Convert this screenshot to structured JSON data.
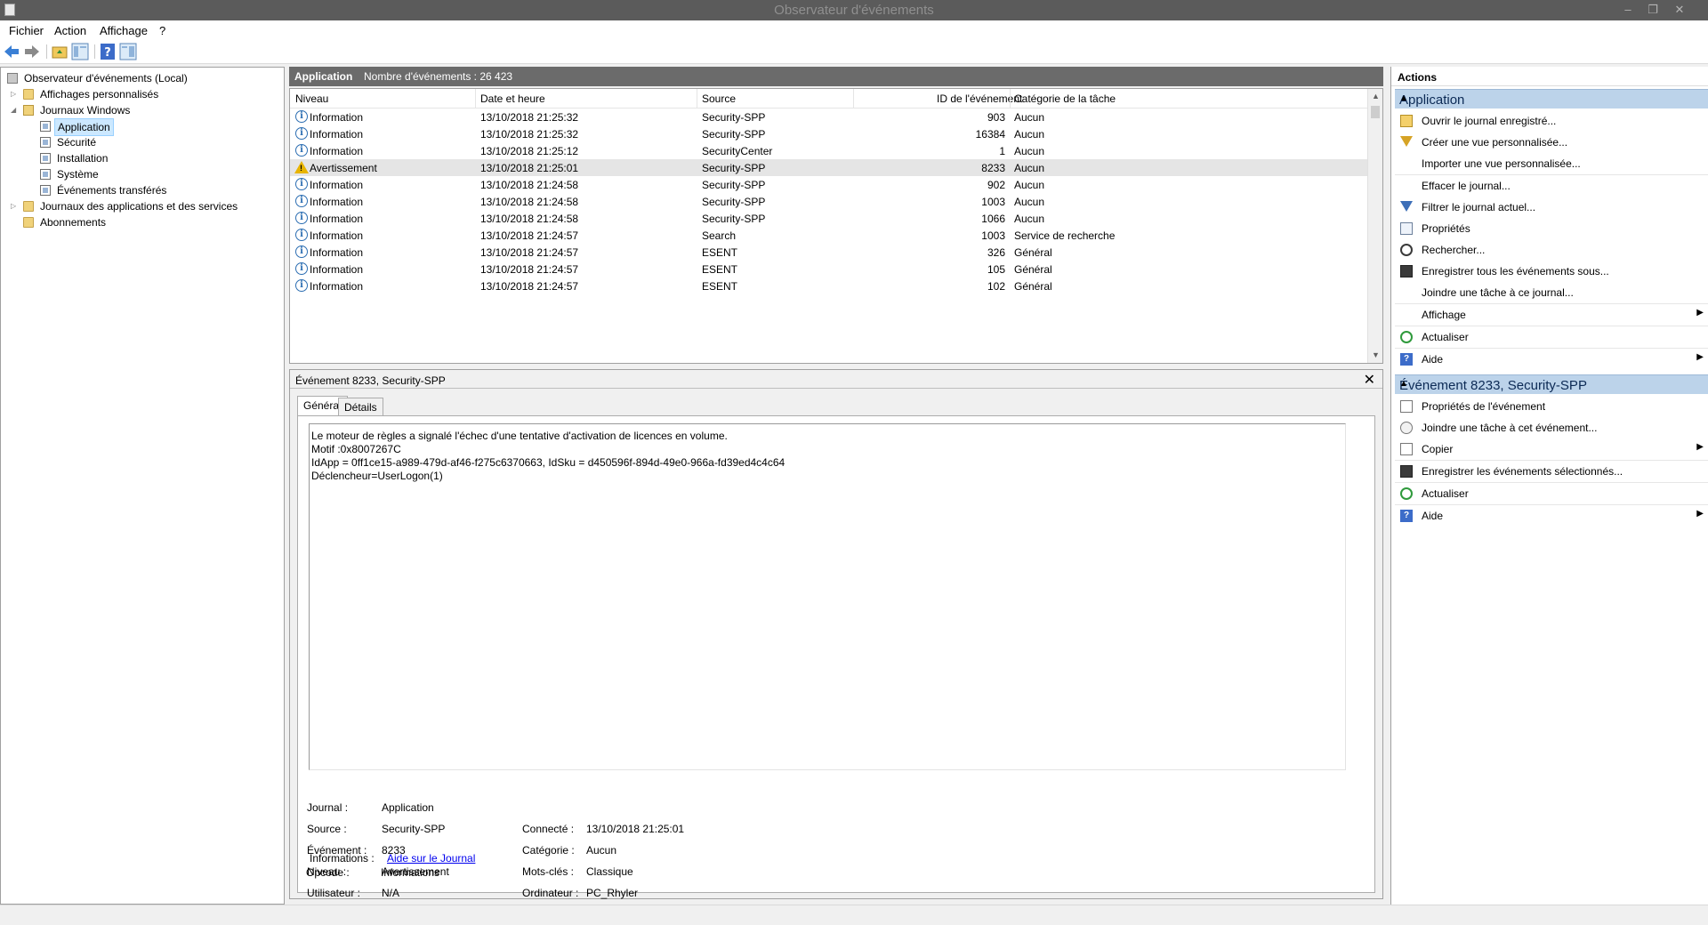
{
  "window": {
    "title": "Observateur d'événements"
  },
  "menu": [
    "Fichier",
    "Action",
    "Affichage",
    "?"
  ],
  "tree": {
    "root": "Observateur d'événements (Local)",
    "custom_views": "Affichages personnalisés",
    "windows_logs": "Journaux Windows",
    "logs": [
      "Application",
      "Sécurité",
      "Installation",
      "Système",
      "Événements transférés"
    ],
    "app_services_logs": "Journaux des applications et des services",
    "subscriptions": "Abonnements"
  },
  "list": {
    "title": "Application",
    "count_text": "Nombre d'événements : 26 423",
    "columns": [
      "Niveau",
      "Date et heure",
      "Source",
      "ID de l'événement",
      "Catégorie de la tâche"
    ],
    "rows": [
      {
        "level": "Information",
        "date": "13/10/2018 21:25:32",
        "source": "Security-SPP",
        "id": "903",
        "category": "Aucun"
      },
      {
        "level": "Information",
        "date": "13/10/2018 21:25:32",
        "source": "Security-SPP",
        "id": "16384",
        "category": "Aucun"
      },
      {
        "level": "Information",
        "date": "13/10/2018 21:25:12",
        "source": "SecurityCenter",
        "id": "1",
        "category": "Aucun"
      },
      {
        "level": "Avertissement",
        "date": "13/10/2018 21:25:01",
        "source": "Security-SPP",
        "id": "8233",
        "category": "Aucun"
      },
      {
        "level": "Information",
        "date": "13/10/2018 21:24:58",
        "source": "Security-SPP",
        "id": "902",
        "category": "Aucun"
      },
      {
        "level": "Information",
        "date": "13/10/2018 21:24:58",
        "source": "Security-SPP",
        "id": "1003",
        "category": "Aucun"
      },
      {
        "level": "Information",
        "date": "13/10/2018 21:24:58",
        "source": "Security-SPP",
        "id": "1066",
        "category": "Aucun"
      },
      {
        "level": "Information",
        "date": "13/10/2018 21:24:57",
        "source": "Search",
        "id": "1003",
        "category": "Service de recherche"
      },
      {
        "level": "Information",
        "date": "13/10/2018 21:24:57",
        "source": "ESENT",
        "id": "326",
        "category": "Général"
      },
      {
        "level": "Information",
        "date": "13/10/2018 21:24:57",
        "source": "ESENT",
        "id": "105",
        "category": "Général"
      },
      {
        "level": "Information",
        "date": "13/10/2018 21:24:57",
        "source": "ESENT",
        "id": "102",
        "category": "Général"
      }
    ]
  },
  "detail": {
    "title": "Événement 8233, Security-SPP",
    "tabs": [
      "Général",
      "Détails"
    ],
    "message": [
      "Le moteur de règles a signalé l'échec d'une tentative d'activation de licences en volume.",
      "Motif :0x8007267C",
      "IdApp = 0ff1ce15-a989-479d-af46-f275c6370663, IdSku = d450596f-894d-49e0-966a-fd39ed4c4c64",
      "Déclencheur=UserLogon(1)"
    ],
    "fields": {
      "journal_label": "Journal :",
      "journal": "Application",
      "source_label": "Source :",
      "source": "Security-SPP",
      "event_label": "Événement :",
      "event": "8233",
      "level_label": "Niveau :",
      "level": "Avertissement",
      "user_label": "Utilisateur :",
      "user": "N/A",
      "opcode_label": "Opcode :",
      "opcode": "Informations",
      "info_label": "Informations :",
      "info_link": "Aide sur le Journal",
      "logged_label": "Connecté :",
      "logged": "13/10/2018 21:25:01",
      "category_label": "Catégorie :",
      "category": "Aucun",
      "keywords_label": "Mots-clés :",
      "keywords": "Classique",
      "computer_label": "Ordinateur :",
      "computer": "PC_Rhyler"
    }
  },
  "actions": {
    "header": "Actions",
    "section1": "Application",
    "items1": [
      "Ouvrir le journal enregistré...",
      "Créer une vue personnalisée...",
      "Importer une vue personnalisée...",
      "Effacer le journal...",
      "Filtrer le journal actuel...",
      "Propriétés",
      "Rechercher...",
      "Enregistrer tous les événements sous...",
      "Joindre une tâche à ce journal...",
      "Affichage",
      "Actualiser",
      "Aide"
    ],
    "section2": "Événement 8233, Security-SPP",
    "items2": [
      "Propriétés de l'événement",
      "Joindre une tâche à cet événement...",
      "Copier",
      "Enregistrer les événements sélectionnés...",
      "Actualiser",
      "Aide"
    ]
  }
}
